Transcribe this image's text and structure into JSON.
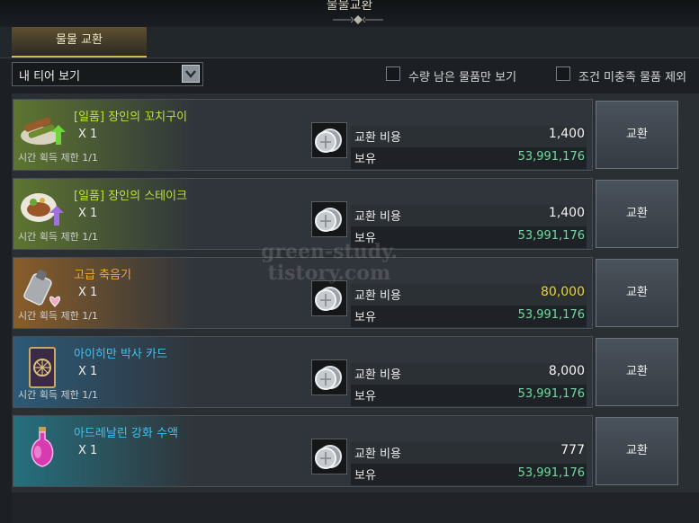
{
  "window": {
    "title": "물물교환"
  },
  "tabs": [
    {
      "label": "물물 교환",
      "active": true
    }
  ],
  "filter": {
    "dropdown_value": "내 티어 보기"
  },
  "checkboxes": [
    {
      "label": "수량 남은 물품만 보기",
      "checked": false
    },
    {
      "label": "조건 미충족 물품 제외",
      "checked": false
    }
  ],
  "items": [
    {
      "name": "[일품] 장인의 꼬치구이",
      "qty": "X 1",
      "limit": "시간 획득 제한 1/1",
      "cost_label": "교환 비용",
      "cost": "1,400",
      "owned_label": "보유",
      "owned": "53,991,176",
      "button": "교환",
      "grade_color": "#bfe23a"
    },
    {
      "name": "[일품] 장인의 스테이크",
      "qty": "X 1",
      "limit": "시간 획득 제한 1/1",
      "cost_label": "교환 비용",
      "cost": "1,400",
      "owned_label": "보유",
      "owned": "53,991,176",
      "button": "교환",
      "grade_color": "#bfe23a"
    },
    {
      "name": "고급 축음기",
      "qty": "X 1",
      "limit": "시간 획득 제한 1/1",
      "cost_label": "교환 비용",
      "cost": "80,000",
      "owned_label": "보유",
      "owned": "53,991,176",
      "button": "교환",
      "grade_color": "#f0a830"
    },
    {
      "name": "아이히만 박사 카드",
      "qty": "X 1",
      "limit": "시간 획득 제한 1/1",
      "cost_label": "교환 비용",
      "cost": "8,000",
      "owned_label": "보유",
      "owned": "53,991,176",
      "button": "교환",
      "grade_color": "#3cc3f0"
    },
    {
      "name": "아드레날린 강화 수액",
      "qty": "X 1",
      "limit": "",
      "cost_label": "교환 비용",
      "cost": "777",
      "owned_label": "보유",
      "owned": "53,991,176",
      "button": "교환",
      "grade_color": "#3cc3f0"
    }
  ],
  "icons": {
    "currency": "silver-coin-icon",
    "dropdown": "chevron-down-icon"
  },
  "watermark": {
    "line1": "green-study.",
    "line2": "tistory.com"
  }
}
